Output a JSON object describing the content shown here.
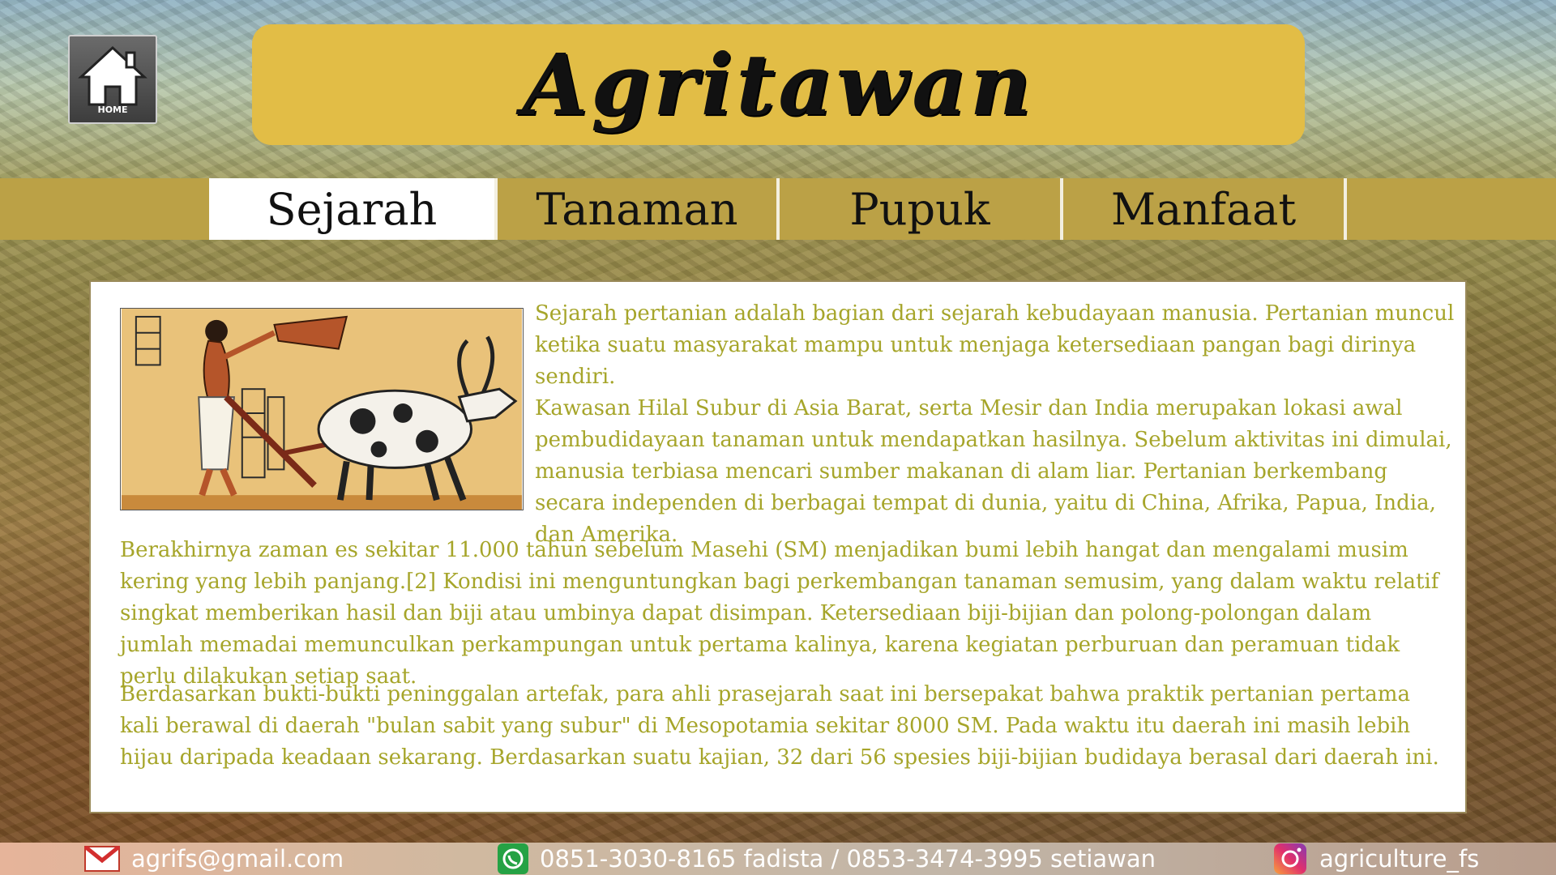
{
  "header": {
    "title": "Agritawan",
    "home_label": "HOME"
  },
  "nav": {
    "tabs": [
      {
        "label": "Sejarah",
        "active": true
      },
      {
        "label": "Tanaman",
        "active": false
      },
      {
        "label": "Pupuk",
        "active": false
      },
      {
        "label": "Manfaat",
        "active": false
      }
    ]
  },
  "content": {
    "paragraphs": [
      "Sejarah pertanian adalah  bagian dari sejarah kebudayaan manusia. Pertanian muncul ketika suatu masyarakat mampu untuk menjaga ketersediaan pangan bagi dirinya sendiri.",
      "Kawasan Hilal Subur di Asia Barat, serta Mesir dan India merupakan lokasi awal pembudidayaan tanaman untuk mendapatkan hasilnya. Sebelum aktivitas ini dimulai, manusia terbiasa mencari sumber makanan di alam liar. Pertanian berkembang secara independen di berbagai tempat di dunia, yaitu di China, Afrika, Papua, India, dan Amerika.",
      "Berakhirnya zaman es sekitar 11.000 tahun sebelum Masehi (SM) menjadikan bumi lebih hangat dan mengalami musim kering yang lebih panjang.[2] Kondisi ini menguntungkan bagi perkembangan tanaman semusim, yang dalam waktu relatif singkat memberikan hasil dan biji atau umbinya dapat disimpan. Ketersediaan biji-bijian dan polong-polongan dalam jumlah memadai memunculkan perkampungan untuk pertama kalinya, karena kegiatan perburuan dan peramuan tidak perlu dilakukan setiap saat.",
      "Berdasarkan bukti-bukti peninggalan artefak, para ahli prasejarah saat ini bersepakat bahwa praktik pertanian pertama kali berawal di daerah \"bulan sabit yang subur\" di Mesopotamia sekitar 8000 SM. Pada waktu itu daerah ini masih lebih hijau daripada keadaan sekarang. Berdasarkan suatu kajian, 32 dari 56 spesies biji-bijian budidaya berasal dari daerah ini."
    ],
    "text_color": "#a6a52a"
  },
  "footer": {
    "email": "agrifs@gmail.com",
    "phone": "0851-3030-8165 fadista / 0853-3474-3995 setiawan",
    "instagram": "agriculture_fs"
  },
  "colors": {
    "title_bg": "#e2bd46",
    "nav_bg": "#bba146",
    "accent_text": "#a6a52a"
  }
}
